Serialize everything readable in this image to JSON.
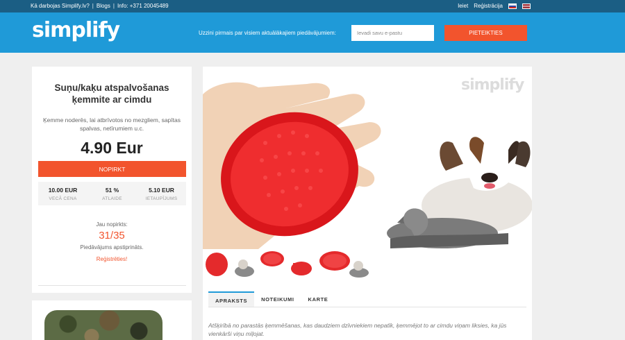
{
  "topbar": {
    "how_it_works": "Kā darbojas Simplify.lv?",
    "blog": "Blogs",
    "info": "Info: +371 20045489",
    "login": "Ieiet",
    "register": "Reģistrācija",
    "sep": "|"
  },
  "header": {
    "logo": "simplify",
    "promo_text": "Uzzini pirmais par visiem aktuālākajiem piedāvājumiem:",
    "email_placeholder": "Ievadi savu e-pastu",
    "subscribe_label": "PIETEIKTIES"
  },
  "deal": {
    "title": "Suņu/kaķu atspalvošanas ķemmite ar cimdu",
    "description": "Ķemme noderēs, lai atbrīvotos no mezgliem, sapītas spalvas, netīrumiem u.c.",
    "price": "4.90 Eur",
    "buy_label": "NOPIRKT",
    "stats": [
      {
        "value": "10.00 EUR",
        "label": "VECĀ CENA"
      },
      {
        "value": "51 %",
        "label": "ATLAIDE"
      },
      {
        "value": "5.10 EUR",
        "label": "IETAUPĪJUMS"
      }
    ],
    "bought_label": "Jau nopirkts:",
    "bought_count": "31/35",
    "confirmed": "Piedāvājums apstiprināts.",
    "register_cta": "Reģistrēties!"
  },
  "gallery": {
    "watermark": "simplify",
    "thumbnail_count": 4
  },
  "tabs": [
    {
      "label": "APRAKSTS",
      "active": true
    },
    {
      "label": "NOTEIKUMI",
      "active": false
    },
    {
      "label": "KARTE",
      "active": false
    }
  ],
  "description_text": "Atšķirībā no parastās ķemmēšanas, kas daudziem dzīvniekiem nepatīk, ķemmējot to ar cimdu viņam liksies, ka jūs vienkārši viņu mīļojat.",
  "colors": {
    "topbar": "#1b5e84",
    "header": "#1f9ad8",
    "accent": "#f2542d",
    "logo_accent": "#f08a24"
  }
}
